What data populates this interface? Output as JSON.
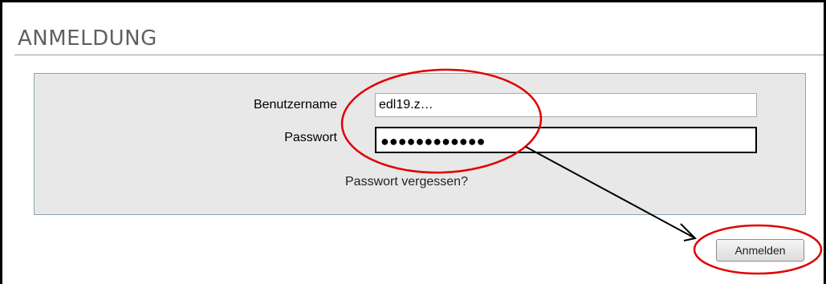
{
  "page": {
    "title": "ANMELDUNG"
  },
  "form": {
    "username_label": "Benutzername",
    "username_value": "edl19.z…",
    "password_label": "Passwort",
    "password_value": "●●●●●●●●●●●●",
    "forgot_link": "Passwort vergessen?",
    "submit_label": "Anmelden"
  },
  "annotations": {
    "color": "#e00000",
    "arrow_color": "#000000"
  }
}
